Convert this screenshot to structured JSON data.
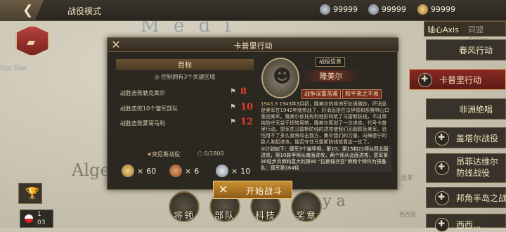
{
  "map": {
    "labels": [
      "M e d i",
      "Algeri",
      "b y a",
      "tan Sea",
      "北非",
      "西西亚"
    ]
  },
  "header": {
    "back_icon": "back-arrow-icon",
    "title": "战役模式",
    "resources": [
      {
        "icon": "silver-coin-icon",
        "value": "99999"
      },
      {
        "icon": "silver-medal-icon",
        "value": "99999"
      },
      {
        "icon": "gold-star-icon",
        "value": "99999"
      }
    ]
  },
  "side": {
    "axis_tab": "轴心Axis",
    "allies_tab": "同盟 Allies",
    "campaigns": [
      {
        "label": "春风行动"
      },
      {
        "label": "卡普里行动",
        "active": true
      },
      {
        "label": "非洲绝唱"
      },
      {
        "label": "盖塔尔战役"
      },
      {
        "label": "昂菲达维尔防线战役"
      },
      {
        "label": "邦角半岛之战"
      },
      {
        "label": "西西..."
      }
    ]
  },
  "bottom_menu": [
    "将领",
    "部队",
    "科技",
    "奖章"
  ],
  "player": {
    "page": "1",
    "total": "03"
  },
  "dialog": {
    "title": "卡普里行动",
    "objectives": {
      "header": "目标",
      "subtitle": "控制拥有3个关键区域",
      "rows": [
        {
          "text": "战胜击败勒克莱尔",
          "value": "8"
        },
        {
          "text": "战胜击败10个皱军部队",
          "value": "10"
        },
        {
          "text": "战胜击败蒙哥马利",
          "value": "12"
        }
      ],
      "progress_label": "突尼斯战役",
      "progress_value": "0/1800"
    },
    "rewards": [
      {
        "icon": "gold-medal-icon",
        "value": "60"
      },
      {
        "icon": "bronze-medal-icon",
        "value": "6"
      },
      {
        "icon": "silver-medal-icon",
        "value": "10"
      }
    ],
    "general": {
      "info_tag": "战役信息",
      "name": "隆美尔",
      "skills": [
        "战争深重苦难",
        "和平来之不易"
      ]
    },
    "story": {
      "year": "1943.3",
      "text": "1943年3月初，隆美尔的非洲军处境微妙，坏消息是美军在1942年底参战了，好消息是在法伊德和凯赛林山口重创美军。隆美尔依托有利地形构筑了马雷斯防线，不过单纯防守无益于扭转局势，隆美尔筹划了一次进攻，代号卡普里行动。盟军在马雷斯防线的进攻使我们无暇顾及美军，恐怕用不了多久就将攻击我方，集中我们的力量，向梅德宁的敌人发起进攻，能否守住马雷斯防线就看这一仗了。",
      "plan": "①计划如下：德军3个装甲师，第10、第15和21师从西北面进攻，第10装甲师从南面进攻，两个师从北面进攻，意军第90轻步兵师和意大利第80 “拉斯佩齐亚”师两个师作为预备队：德军第164轻"
    },
    "start_button": "开始战斗"
  }
}
